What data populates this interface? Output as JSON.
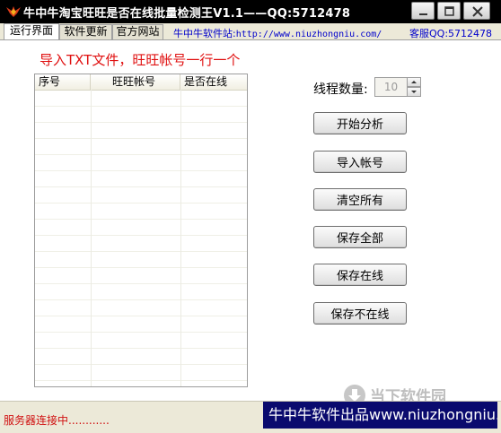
{
  "window": {
    "title": "牛中牛淘宝旺旺是否在线批量检测王V1.1——QQ:5712478"
  },
  "tabs": [
    {
      "label": "运行界面",
      "active": true
    },
    {
      "label": "软件更新",
      "active": false
    },
    {
      "label": "官方网站",
      "active": false
    }
  ],
  "header_links": {
    "site_label": "牛中牛软件站:",
    "site_url": "http://www.niuzhongniu.com/",
    "service_qq": "客服QQ:5712478"
  },
  "main": {
    "import_heading": "导入TXT文件，旺旺帐号一行一个",
    "table": {
      "columns": [
        "序号",
        "旺旺帐号",
        "是否在线"
      ],
      "rows": []
    },
    "thread_count": {
      "label": "线程数量:",
      "value": "10"
    },
    "buttons": {
      "start": "开始分析",
      "import": "导入帐号",
      "clear": "清空所有",
      "save_all": "保存全部",
      "save_online": "保存在线",
      "save_offline": "保存不在线"
    }
  },
  "status": {
    "text": "服务器连接中............"
  },
  "banner": {
    "text": "牛中牛软件出品www.niuzhongniu.com"
  },
  "watermark": {
    "text": "当下软件园"
  },
  "colors": {
    "heading_red": "#e01010",
    "link_blue": "#0000cc",
    "banner_bg": "#0a0a6e",
    "titlebar_bg": "#000000"
  }
}
